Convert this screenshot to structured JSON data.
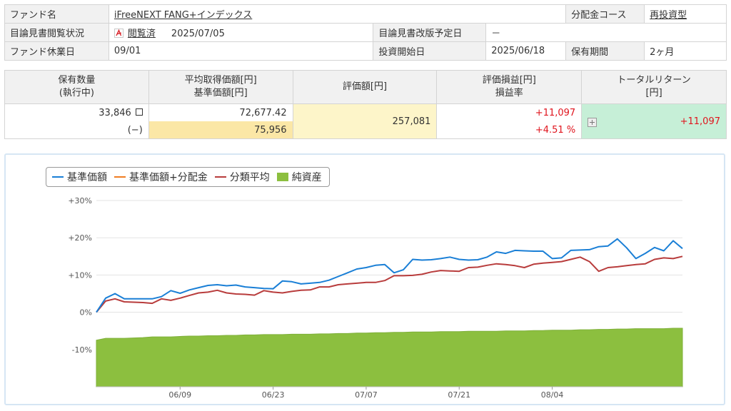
{
  "fund_info": {
    "fund_name_label": "ファンド名",
    "fund_name": "iFreeNEXT FANG+インデックス",
    "dist_course_label": "分配金コース",
    "dist_course": "再投資型",
    "prospectus_status_label": "目論見書閲覧状況",
    "prospectus_status": "閲覧済",
    "prospectus_date": "2025/07/05",
    "revision_label": "目論見書改版予定日",
    "revision_value": "－",
    "holiday_label": "ファンド休業日",
    "holiday_value": "09/01",
    "invest_start_label": "投資開始日",
    "invest_start_value": "2025/06/18",
    "holding_period_label": "保有期間",
    "holding_period_value": "2ヶ月"
  },
  "holdings": {
    "headers": {
      "qty_line1": "保有数量",
      "qty_line2": "(執行中)",
      "avg_line1": "平均取得価額[円]",
      "avg_line2": "基準価額[円]",
      "value": "評価額[円]",
      "pl_line1": "評価損益[円]",
      "pl_line2": "損益率",
      "total_line1": "トータルリターン",
      "total_line2": "[円]"
    },
    "qty": "33,846",
    "qty_pending": "(−)",
    "avg_cost": "72,677.42",
    "nav": "75,956",
    "valuation": "257,081",
    "pl": "+11,097",
    "pl_rate": "+4.51 %",
    "total_return": "+11,097"
  },
  "colors": {
    "nav": "#1a7fd6",
    "nav_dist": "#f07d22",
    "category_avg": "#b83c3c",
    "net_assets": "#8cbf3f"
  },
  "chart_data": {
    "type": "line",
    "title": "",
    "legend": [
      "基準価額",
      "基準価額+分配金",
      "分類平均",
      "純資産"
    ],
    "legend_position": "top-left",
    "y_ticks": [
      "+30%",
      "+20%",
      "+10%",
      "0%",
      "-10%"
    ],
    "ylim": [
      -20,
      30
    ],
    "x_ticks": [
      "06/09",
      "06/23",
      "07/07",
      "07/21",
      "08/04"
    ],
    "x_tick_index": [
      9,
      19,
      29,
      39,
      49
    ],
    "x_count": 64,
    "series": [
      {
        "name": "基準価額",
        "values": [
          0,
          3.8,
          5.0,
          3.6,
          3.6,
          3.6,
          3.6,
          4.2,
          5.8,
          5.1,
          6.0,
          6.6,
          7.2,
          7.4,
          7.1,
          7.3,
          6.8,
          6.6,
          6.4,
          6.3,
          8.4,
          8.2,
          7.6,
          7.8,
          8.0,
          8.6,
          9.6,
          10.6,
          11.6,
          12.0,
          12.6,
          12.8,
          10.6,
          11.4,
          14.2,
          14.0,
          14.1,
          14.4,
          14.8,
          14.2,
          14.0,
          14.1,
          14.8,
          16.2,
          15.8,
          16.6,
          16.5,
          16.4,
          16.4,
          14.4,
          14.6,
          16.6,
          16.7,
          16.8,
          17.6,
          17.8,
          19.7,
          17.3,
          14.4,
          15.8,
          17.4,
          16.5,
          19.2,
          17.1
        ],
        "x_index_fix": true
      },
      {
        "name": "分類平均",
        "values": [
          0,
          3.0,
          3.6,
          2.8,
          2.7,
          2.6,
          2.4,
          3.6,
          3.2,
          3.8,
          4.5,
          5.2,
          5.4,
          5.9,
          5.2,
          4.9,
          4.8,
          4.6,
          5.8,
          5.4,
          5.2,
          5.6,
          5.9,
          6.0,
          6.8,
          6.8,
          7.4,
          7.6,
          7.8,
          8.0,
          8.0,
          8.5,
          9.8,
          9.8,
          9.9,
          10.2,
          10.8,
          11.2,
          11.1,
          11.0,
          12.0,
          12.1,
          12.6,
          13.0,
          12.8,
          12.5,
          12.0,
          12.9,
          13.2,
          13.4,
          13.6,
          14.2,
          14.8,
          13.6,
          11.0,
          12.0,
          12.2,
          12.5,
          12.8,
          13.0,
          14.2,
          14.6,
          14.4,
          15.0
        ]
      },
      {
        "name": "純資産",
        "values": [
          -7.5,
          -7.0,
          -7.0,
          -7.0,
          -6.9,
          -6.8,
          -6.6,
          -6.6,
          -6.6,
          -6.5,
          -6.4,
          -6.4,
          -6.3,
          -6.3,
          -6.2,
          -6.2,
          -6.1,
          -6.1,
          -6.0,
          -6.0,
          -6.0,
          -5.9,
          -5.9,
          -5.9,
          -5.8,
          -5.8,
          -5.7,
          -5.7,
          -5.6,
          -5.6,
          -5.5,
          -5.5,
          -5.4,
          -5.4,
          -5.3,
          -5.3,
          -5.3,
          -5.2,
          -5.2,
          -5.2,
          -5.1,
          -5.1,
          -5.1,
          -5.1,
          -5.0,
          -5.0,
          -5.0,
          -4.9,
          -4.9,
          -4.8,
          -4.8,
          -4.8,
          -4.7,
          -4.7,
          -4.6,
          -4.6,
          -4.5,
          -4.5,
          -4.4,
          -4.4,
          -4.4,
          -4.4,
          -4.3,
          -4.3
        ]
      }
    ]
  }
}
